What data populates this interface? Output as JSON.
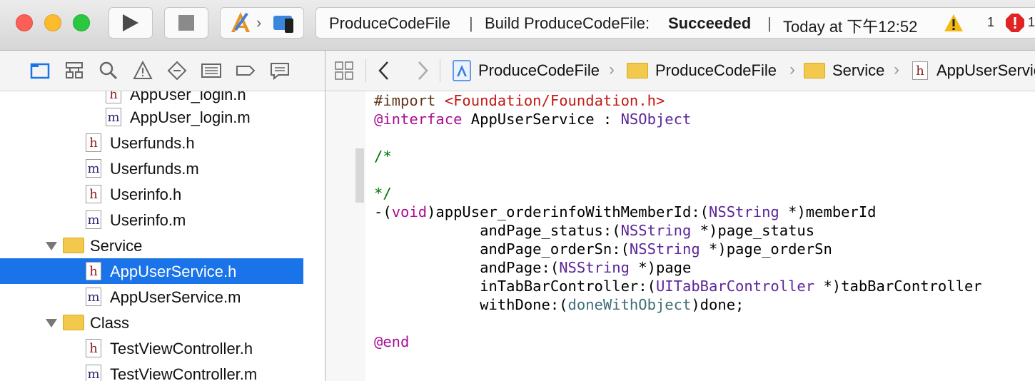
{
  "toolbar": {
    "activity_project": "ProduceCodeFile",
    "activity_sep1": "|",
    "activity_build_prefix": "Build ProduceCodeFile:",
    "activity_build_status": "Succeeded",
    "activity_sep2": "|",
    "activity_time": "Today at 下午12:52",
    "warnings_count": "1",
    "errors_count": "1"
  },
  "navigator": {
    "rows": [
      {
        "label": "AppUser_login.h",
        "type": "h",
        "selected": false
      },
      {
        "label": "AppUser_login.m",
        "type": "m",
        "selected": false
      },
      {
        "label": "Userfunds.h",
        "type": "h",
        "selected": false
      },
      {
        "label": "Userfunds.m",
        "type": "m",
        "selected": false
      },
      {
        "label": "Userinfo.h",
        "type": "h",
        "selected": false
      },
      {
        "label": "Userinfo.m",
        "type": "m",
        "selected": false
      },
      {
        "label": "Service",
        "type": "group",
        "selected": false
      },
      {
        "label": "AppUserService.h",
        "type": "h",
        "selected": true
      },
      {
        "label": "AppUserService.m",
        "type": "m",
        "selected": false
      },
      {
        "label": "Class",
        "type": "group",
        "selected": false
      },
      {
        "label": "TestViewController.h",
        "type": "h",
        "selected": false
      },
      {
        "label": "TestViewController.m",
        "type": "m",
        "selected": false
      }
    ]
  },
  "jumpbar": {
    "crumbs": [
      "ProduceCodeFile",
      "ProduceCodeFile",
      "Service",
      "AppUserService.h"
    ]
  },
  "editor": {
    "lines": [
      [
        [
          "pp",
          "#import "
        ],
        [
          "str",
          "<Foundation/Foundation.h>"
        ]
      ],
      [
        [
          "kw",
          "@interface"
        ],
        [
          "pl",
          " AppUserService : "
        ],
        [
          "ty",
          "NSObject"
        ]
      ],
      [],
      [
        [
          "cm",
          "/*"
        ]
      ],
      [],
      [
        [
          "cm",
          "*/"
        ]
      ],
      [
        [
          "pl",
          "-("
        ],
        [
          "kw",
          "void"
        ],
        [
          "pl",
          ")appUser_orderinfoWithMemberId:("
        ],
        [
          "ty",
          "NSString"
        ],
        [
          "pl",
          " *)memberId"
        ]
      ],
      [
        [
          "pl",
          "            andPage_status:("
        ],
        [
          "ty",
          "NSString"
        ],
        [
          "pl",
          " *)page_status"
        ]
      ],
      [
        [
          "pl",
          "            andPage_orderSn:("
        ],
        [
          "ty",
          "NSString"
        ],
        [
          "pl",
          " *)page_orderSn"
        ]
      ],
      [
        [
          "pl",
          "            andPage:("
        ],
        [
          "ty",
          "NSString"
        ],
        [
          "pl",
          " *)page"
        ]
      ],
      [
        [
          "pl",
          "            inTabBarController:("
        ],
        [
          "ty",
          "UITabBarController"
        ],
        [
          "pl",
          " *)tabBarController"
        ]
      ],
      [
        [
          "pl",
          "            withDone:("
        ],
        [
          "fn",
          "doneWithObject"
        ],
        [
          "pl",
          ")done;"
        ]
      ],
      [],
      [
        [
          "kw",
          "@end"
        ]
      ]
    ]
  },
  "colors": {
    "selection": "#1a73e8",
    "keyword": "#aa0d91",
    "type": "#5c2699",
    "string": "#c41a16",
    "comment": "#007400",
    "preprocessor": "#643820",
    "function_type": "#3f6e74"
  }
}
